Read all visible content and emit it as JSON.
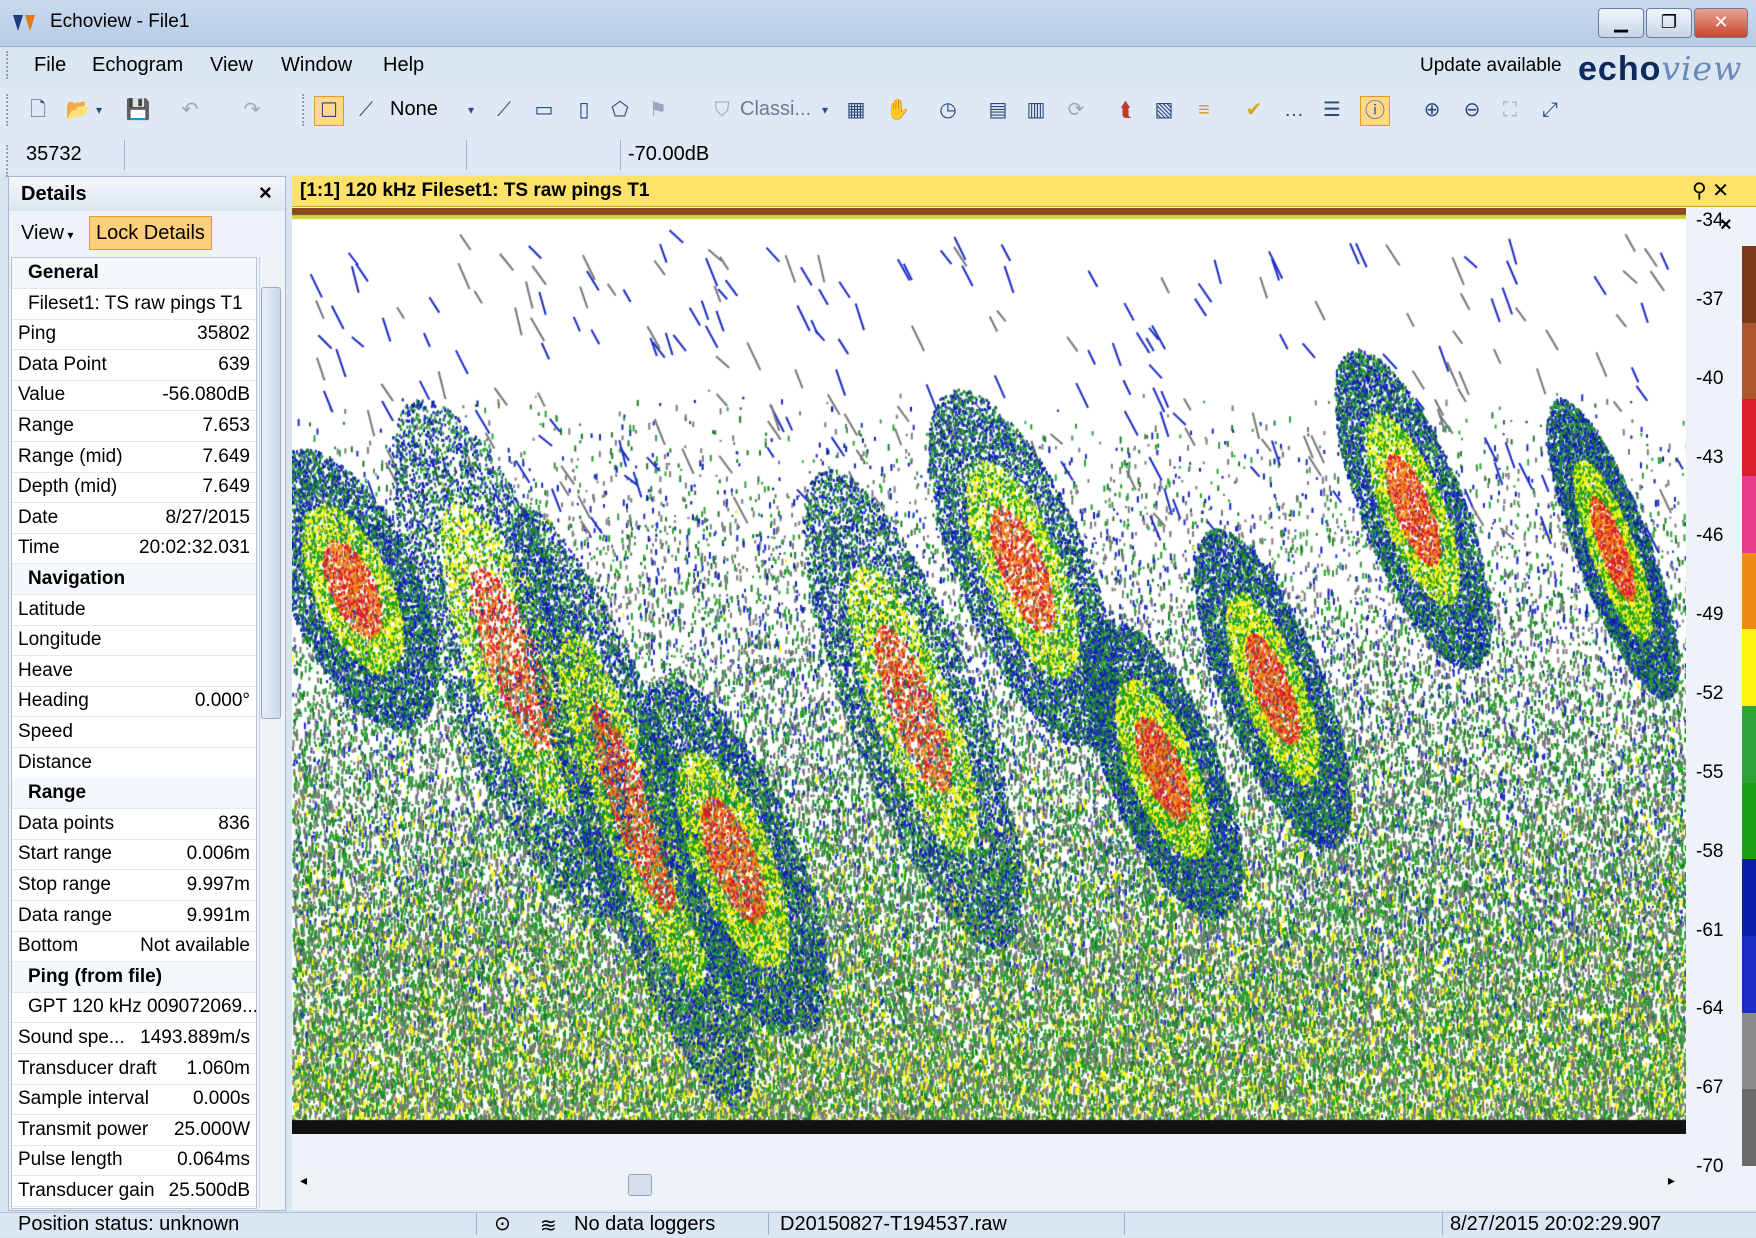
{
  "window": {
    "title": "Echoview - File1"
  },
  "menu": [
    "File",
    "Echogram",
    "View",
    "Window",
    "Help"
  ],
  "update": {
    "text": "Update available",
    "logo_bold": "echo",
    "logo_italic": "view"
  },
  "toolbar": {
    "line_mode": "None",
    "classification": "Classi..."
  },
  "inforow": {
    "ping": "35732",
    "value": "-70.00dB"
  },
  "details": {
    "title": "Details",
    "view_label": "View",
    "lock_label": "Lock Details",
    "rows": [
      {
        "k": "General",
        "v": "",
        "type": "section"
      },
      {
        "k": "Fileset1: TS raw pings T1",
        "v": "",
        "type": "full"
      },
      {
        "k": "Ping",
        "v": "35802"
      },
      {
        "k": "Data Point",
        "v": "639"
      },
      {
        "k": "Value",
        "v": "-56.080dB"
      },
      {
        "k": "Range",
        "v": "7.653"
      },
      {
        "k": "Range (mid)",
        "v": "7.649"
      },
      {
        "k": "Depth (mid)",
        "v": "7.649"
      },
      {
        "k": "Date",
        "v": "8/27/2015"
      },
      {
        "k": "Time",
        "v": "20:02:32.031"
      },
      {
        "k": "Navigation",
        "v": "",
        "type": "section"
      },
      {
        "k": "Latitude",
        "v": ""
      },
      {
        "k": "Longitude",
        "v": ""
      },
      {
        "k": "Heave",
        "v": ""
      },
      {
        "k": "Heading",
        "v": "0.000°"
      },
      {
        "k": "Speed",
        "v": ""
      },
      {
        "k": "Distance",
        "v": ""
      },
      {
        "k": "Range",
        "v": "",
        "type": "section"
      },
      {
        "k": "Data points",
        "v": "836"
      },
      {
        "k": "Start range",
        "v": "0.006m"
      },
      {
        "k": "Stop range",
        "v": "9.997m"
      },
      {
        "k": "Data range",
        "v": "9.991m"
      },
      {
        "k": "Bottom",
        "v": "Not available"
      },
      {
        "k": "Ping (from file)",
        "v": "",
        "type": "section"
      },
      {
        "k": "GPT 120 kHz 009072069...",
        "v": "",
        "type": "full"
      },
      {
        "k": "Sound spe...",
        "v": "1493.889m/s"
      },
      {
        "k": "Transducer draft",
        "v": "1.060m"
      },
      {
        "k": "Sample interval",
        "v": "0.000s"
      },
      {
        "k": "Transmit power",
        "v": "25.000W"
      },
      {
        "k": "Pulse length",
        "v": "0.064ms"
      },
      {
        "k": "Transducer gain",
        "v": "25.500dB"
      }
    ]
  },
  "echogram": {
    "title": "[1:1] 120 kHz Fileset1: TS raw pings T1"
  },
  "colorbar": {
    "labels": [
      "-34",
      "-37",
      "-40",
      "-43",
      "-46",
      "-49",
      "-52",
      "-55",
      "-58",
      "-61",
      "-64",
      "-67",
      "-70"
    ],
    "colors": [
      "#7a3a1a",
      "#b0562e",
      "#d81e2a",
      "#e83c8a",
      "#f08a14",
      "#fbf410",
      "#2fa33a",
      "#1aa01a",
      "#0a1fa8",
      "#1a2cc4",
      "#8c8c8c",
      "#6a6a6a"
    ]
  },
  "status": {
    "position": "Position status: unknown",
    "loggers": "No data loggers",
    "file": "D20150827-T194537.raw",
    "datetime": "8/27/2015 20:02:29.907"
  }
}
